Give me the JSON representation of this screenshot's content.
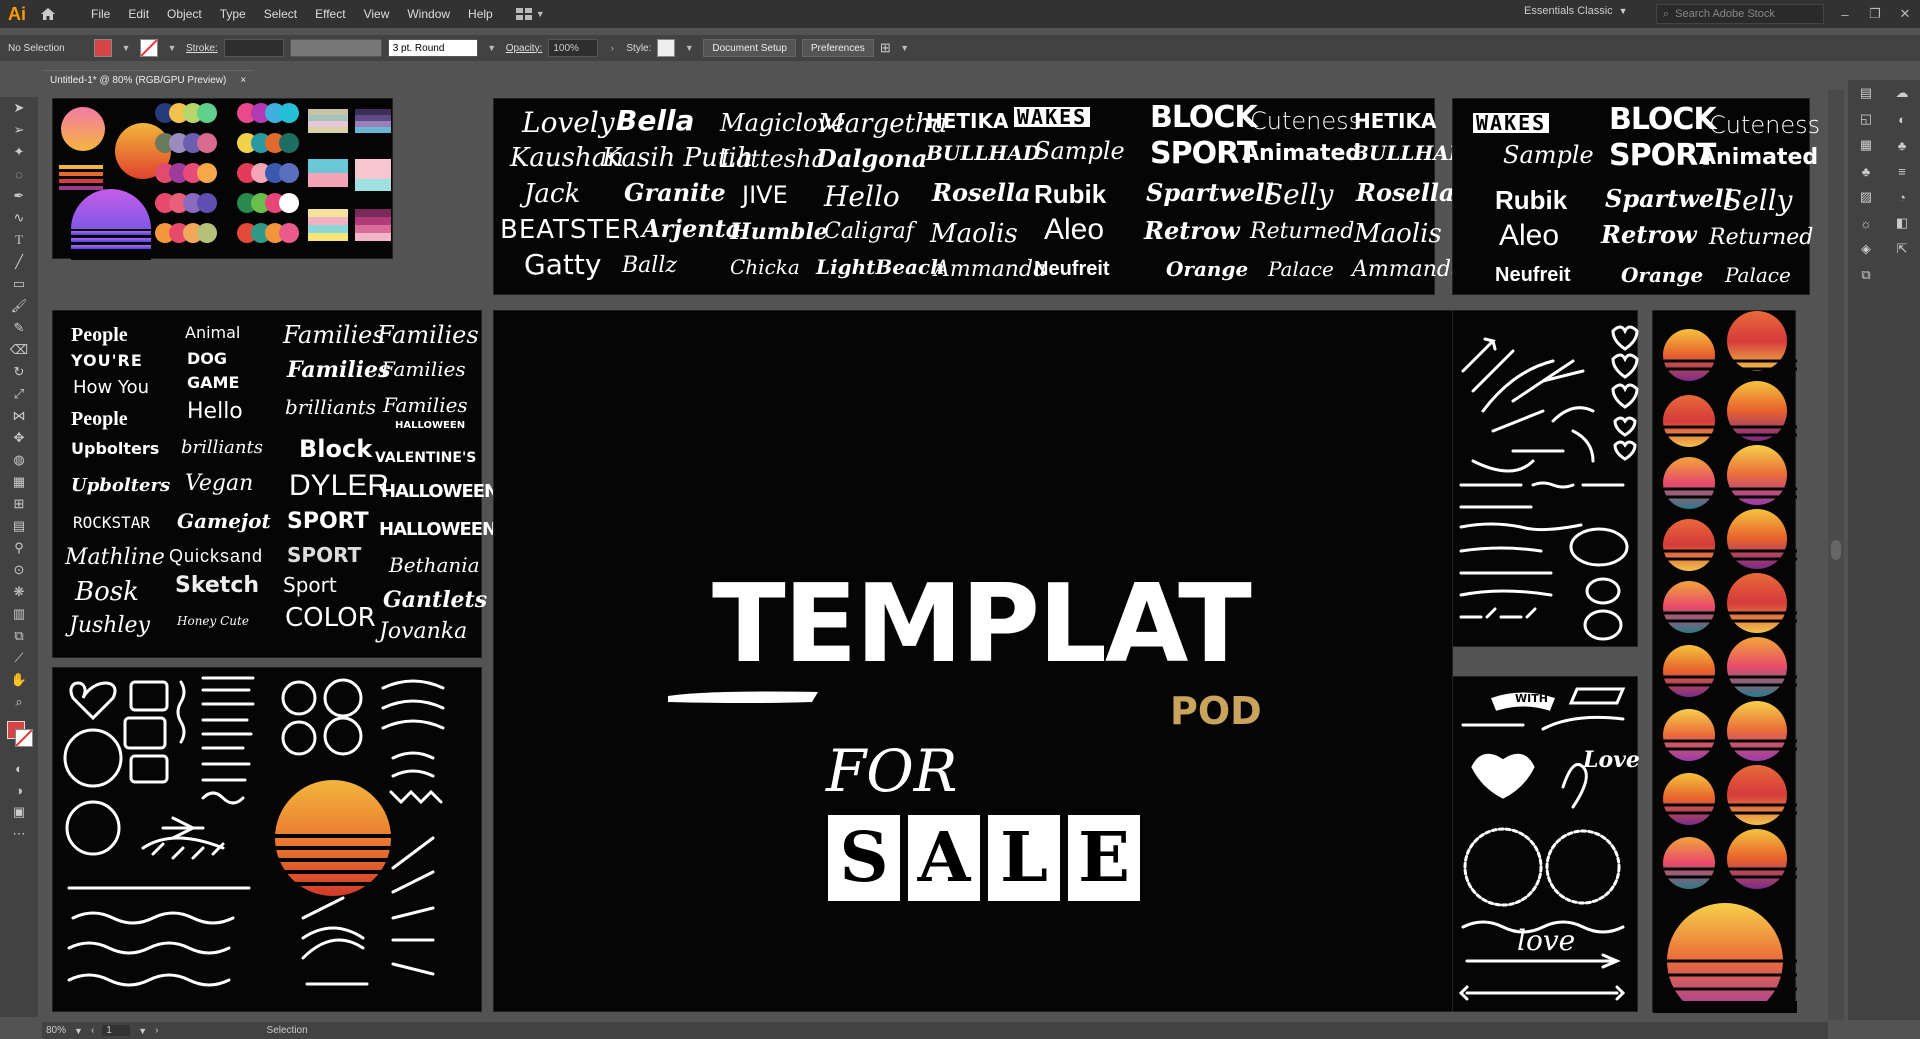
{
  "app": {
    "logo": "Ai"
  },
  "menu": [
    "File",
    "Edit",
    "Object",
    "Type",
    "Select",
    "Effect",
    "View",
    "Window",
    "Help"
  ],
  "workspace": {
    "label": "Essentials Classic"
  },
  "search": {
    "placeholder": "Search Adobe Stock"
  },
  "control_bar": {
    "selection": "No Selection",
    "stroke_label": "Stroke:",
    "brush": "3 pt. Round",
    "opacity_label": "Opacity:",
    "opacity_value": "100%",
    "style_label": "Style:",
    "doc_setup": "Document Setup",
    "preferences": "Preferences"
  },
  "doc_tab": {
    "title": "Untitled-1* @ 80% (RGB/GPU Preview)",
    "close": "×"
  },
  "status": {
    "zoom": "80%",
    "artboard": "1",
    "tool": "Selection"
  },
  "colors": {
    "accent_red": "#d64545",
    "pod_gold": "#caa45c"
  },
  "hero": {
    "title": "TEMPLAT",
    "pod": "POD",
    "for": "FOR",
    "sale": [
      "S",
      "A",
      "L",
      "E"
    ]
  },
  "fonts_top_mid": {
    "col1": [
      "Lovely",
      "Kaushan",
      "Jack",
      "BEATSTER",
      "Gatty"
    ],
    "col2": [
      "Bella",
      "Kasih Putih",
      "Granite",
      "Arjenta",
      "Ballz"
    ],
    "col3": [
      "Magiclove",
      "Lattesha",
      "JIVE",
      "Humble",
      "Chicka"
    ],
    "col4": [
      "Margetha",
      "Dalgona",
      "Hello",
      "Caligraf",
      "LightBeach"
    ],
    "col5": [
      "HETIKA",
      "BULLHAD",
      "Rosella",
      "Maolis",
      "Ammanda"
    ],
    "col6": [
      "WAKES",
      "Sample",
      "Rubik",
      "Aleo",
      "Neufreit"
    ],
    "col7": [
      "BLOCK",
      "SPORT",
      "Spartwell",
      "Retrow",
      "Orange"
    ],
    "col8": [
      "Cuteness",
      "Animated",
      "Selly",
      "Returned",
      "Palace"
    ],
    "col9": [
      "HETIKA",
      "BULLHAD",
      "Rosella",
      "Maolis",
      "Ammanda"
    ]
  },
  "fonts_top_right": {
    "col1": [
      "WAKES",
      "Sample",
      "Rubik",
      "Aleo",
      "Neufreit"
    ],
    "col2": [
      "BLOCK",
      "SPORT",
      "Spartwell",
      "Retrow",
      "Orange"
    ],
    "col3": [
      "Cuteness",
      "Animated",
      "Selly",
      "Returned",
      "Palace"
    ]
  },
  "fonts_left": {
    "col1": [
      "People",
      "YOU'RE",
      "How You",
      "People",
      "Upbolters",
      "Upbolters",
      "ROCKSTAR",
      "Mathline",
      "Bosk",
      "Jushley"
    ],
    "col2": [
      "Animal",
      "DOG",
      "GAME",
      "Hello",
      "brilliants",
      "Vegan",
      "Gamejot",
      "Quicksand",
      "Sketch",
      "Honey Cute"
    ],
    "col3": [
      "Families",
      "Families",
      "brilliants",
      "Block",
      "DYLER",
      "SPORT",
      "SPORT",
      "Sport",
      "COLOR"
    ],
    "col4": [
      "Families",
      "Families",
      "Families",
      "HALLOWEEN",
      "VALENTINE'S",
      "HALLOWEEN",
      "HALLOWEEN",
      "Bethania",
      "Gantlets",
      "Jovanka"
    ]
  },
  "decor": {
    "with": "WITH",
    "love": "Love",
    "love2": "love"
  }
}
